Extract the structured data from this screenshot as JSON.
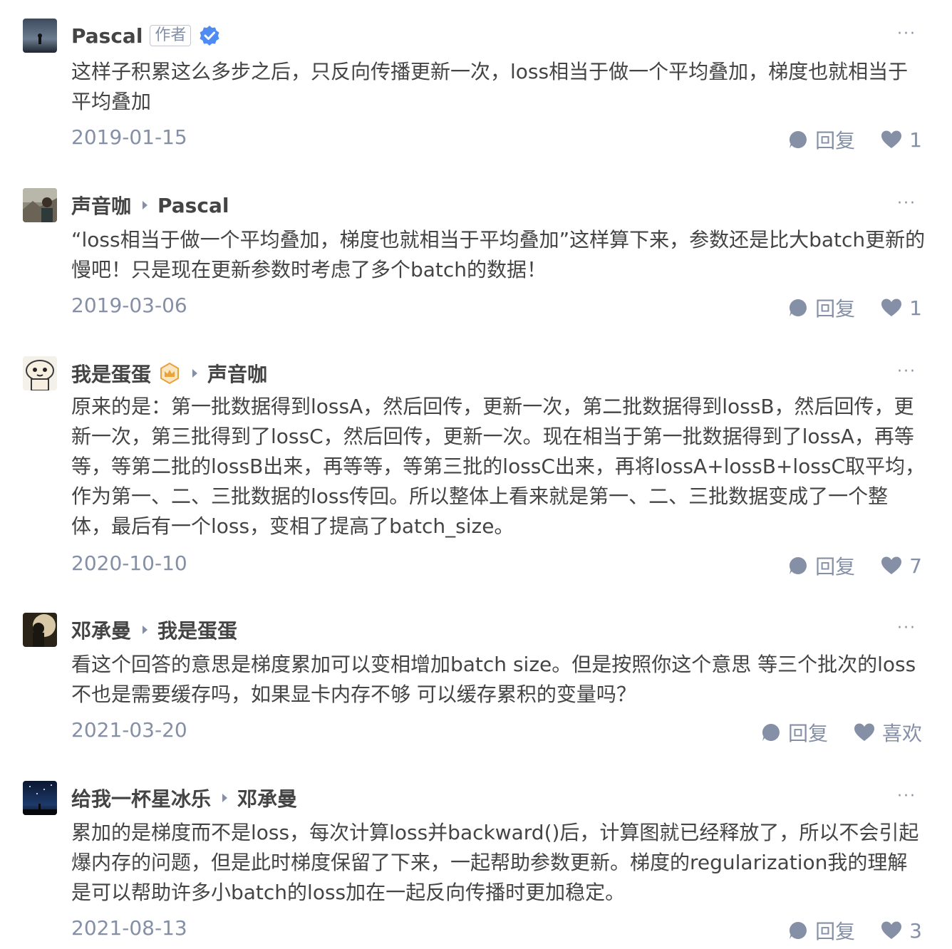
{
  "comments": [
    {
      "author": "Pascal",
      "author_tag": "作者",
      "reply_to": "",
      "text": "这样子积累这么多步之后，只反向传播更新一次，loss相当于做一个平均叠加，梯度也就相当于平均叠加",
      "date": "2019-01-15",
      "reply_label": "回复",
      "like_label": "1"
    },
    {
      "author": "声音咖",
      "reply_to": "Pascal",
      "text": "“loss相当于做一个平均叠加，梯度也就相当于平均叠加”这样算下来，参数还是比大batch更新的慢吧！只是现在更新参数时考虑了多个batch的数据！",
      "date": "2019-03-06",
      "reply_label": "回复",
      "like_label": "1"
    },
    {
      "author": "我是蛋蛋",
      "reply_to": "声音咖",
      "text": "原来的是：第一批数据得到lossA，然后回传，更新一次，第二批数据得到lossB，然后回传，更新一次，第三批得到了lossC，然后回传，更新一次。现在相当于第一批数据得到了lossA，再等等，等第二批的lossB出来，再等等，等第三批的lossC出来，再将lossA+lossB+lossC取平均，作为第一、二、三批数据的loss传回。所以整体上看来就是第一、二、三批数据变成了一个整体，最后有一个loss，变相了提高了batch_size。",
      "date": "2020-10-10",
      "reply_label": "回复",
      "like_label": "7"
    },
    {
      "author": "邓承曼",
      "reply_to": "我是蛋蛋",
      "text": "看这个回答的意思是梯度累加可以变相增加batch size。但是按照你这个意思 等三个批次的loss不也是需要缓存吗，如果显卡内存不够 可以缓存累积的变量吗？",
      "date": "2021-03-20",
      "reply_label": "回复",
      "like_label": "喜欢"
    },
    {
      "author": "给我一杯星冰乐",
      "reply_to": "邓承曼",
      "text": "累加的是梯度而不是loss，每次计算loss并backward()后，计算图就已经释放了，所以不会引起爆内存的问题，但是此时梯度保留了下来，一起帮助参数更新。梯度的regularization我的理解是可以帮助许多小batch的loss加在一起反向传播时更加稳定。",
      "date": "2021-08-13",
      "reply_label": "回复",
      "like_label": "3"
    }
  ],
  "more_label": "···",
  "icons": {
    "verified": "verified-badge-icon",
    "crown": "crown-badge-icon",
    "reply": "speech-bubble-icon",
    "like": "heart-icon",
    "more": "more-dots-icon"
  },
  "colors": {
    "text": "#444444",
    "muted": "#8590a6",
    "verified_blue": "#4e8cf4",
    "crown_gold": "#e8a33d"
  }
}
